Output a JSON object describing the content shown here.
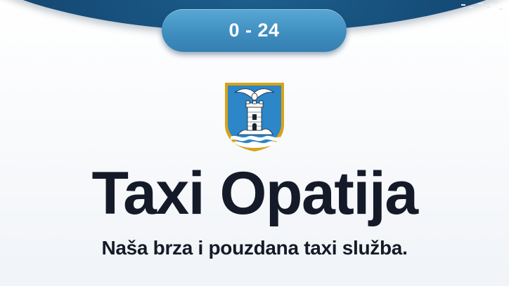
{
  "header": {
    "hours_label": "0 - 24"
  },
  "hero": {
    "logo_icon": "opatija-coat-of-arms-icon",
    "title": "Taxi Opatija",
    "subtitle": "Naša brza i pouzdana taxi služba."
  },
  "colors": {
    "band": "#154b76",
    "pill": "#3f8fc0",
    "text": "#141a28",
    "crest_border": "#d7a317",
    "crest_field": "#2c86c8"
  }
}
